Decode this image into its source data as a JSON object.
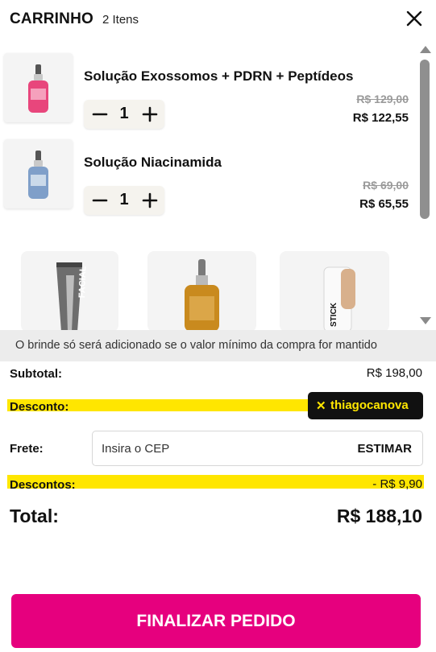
{
  "header": {
    "title": "CARRINHO",
    "count": "2 Itens"
  },
  "items": [
    {
      "name": "Solução Exossomos + PDRN + Peptídeos",
      "qty": "1",
      "old_price": "R$ 129,00",
      "price": "R$ 122,55",
      "bottle_color": "#e8467c",
      "icon": "serum-bottle-pink"
    },
    {
      "name": "Solução Niacinamida",
      "qty": "1",
      "old_price": "R$ 69,00",
      "price": "R$ 65,55",
      "bottle_color": "#7f9fc9",
      "icon": "serum-bottle-blue"
    }
  ],
  "gifts": [
    {
      "label": "FACIAL",
      "icon": "tube-icon"
    },
    {
      "label": "",
      "icon": "amber-serum-icon"
    },
    {
      "label": "STICK",
      "icon": "stick-icon"
    }
  ],
  "notice": "O brinde só será adicionado se o valor mínimo da compra for mantido",
  "summary": {
    "subtotal_label": "Subtotal:",
    "subtotal_value": "R$ 198,00",
    "discount_label": "Desconto:",
    "coupon_code": "thiagocanova",
    "coupon_remove": "✕",
    "shipping_label": "Frete:",
    "cep_placeholder": "Insira o CEP",
    "estimate_label": "ESTIMAR",
    "discounts_label": "Descontos:",
    "discounts_value": "- R$ 9,90",
    "total_label": "Total:",
    "total_value": "R$ 188,10"
  },
  "checkout_label": "FINALIZAR PEDIDO",
  "colors": {
    "accent": "#e6007e",
    "highlight": "#ffe600",
    "coupon_bg": "#111111"
  }
}
